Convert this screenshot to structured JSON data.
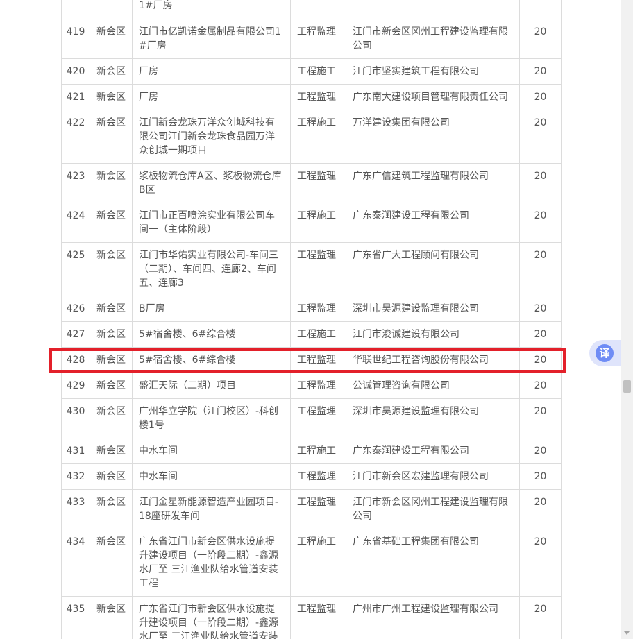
{
  "rows": [
    {
      "num": "",
      "district": "",
      "project": "1#厂房",
      "type": "",
      "company": "",
      "score": ""
    },
    {
      "num": "419",
      "district": "新会区",
      "project": "江门市亿凯诺金属制品有限公司1#厂房",
      "type": "工程监理",
      "company": "江门市新会区冈州工程建设监理有限公司",
      "score": "20"
    },
    {
      "num": "420",
      "district": "新会区",
      "project": "厂房",
      "type": "工程施工",
      "company": "江门市坚实建筑工程有限公司",
      "score": "20"
    },
    {
      "num": "421",
      "district": "新会区",
      "project": "厂房",
      "type": "工程监理",
      "company": "广东南大建设项目管理有限责任公司",
      "score": "20"
    },
    {
      "num": "422",
      "district": "新会区",
      "project": "江门新会龙珠万洋众创城科技有限公司江门新会龙珠食品园万洋众创城一期项目",
      "type": "工程施工",
      "company": "万洋建设集团有限公司",
      "score": "20"
    },
    {
      "num": "423",
      "district": "新会区",
      "project": "浆板物流仓库A区、浆板物流仓库B区",
      "type": "工程监理",
      "company": "广东广信建筑工程监理有限公司",
      "score": "20"
    },
    {
      "num": "424",
      "district": "新会区",
      "project": "江门市正百喷涂实业有限公司车间一（主体阶段）",
      "type": "工程施工",
      "company": "广东泰润建设工程有限公司",
      "score": "20"
    },
    {
      "num": "425",
      "district": "新会区",
      "project": "江门市华佑实业有限公司-车间三（二期）、车间四、连廊2、车间五、连廊3",
      "type": "工程监理",
      "company": "广东省广大工程顾问有限公司",
      "score": "20"
    },
    {
      "num": "426",
      "district": "新会区",
      "project": "B厂房",
      "type": "工程监理",
      "company": "深圳市昊源建设监理有限公司",
      "score": "20"
    },
    {
      "num": "427",
      "district": "新会区",
      "project": "5#宿舍楼、6#综合楼",
      "type": "工程施工",
      "company": "江门市浚诚建设有限公司",
      "score": "20"
    },
    {
      "num": "428",
      "district": "新会区",
      "project": "5#宿舍楼、6#综合楼",
      "type": "工程监理",
      "company": "华联世纪工程咨询股份有限公司",
      "score": "20"
    },
    {
      "num": "429",
      "district": "新会区",
      "project": "盛汇天际（二期）项目",
      "type": "工程监理",
      "company": "公诚管理咨询有限公司",
      "score": "20"
    },
    {
      "num": "430",
      "district": "新会区",
      "project": "广州华立学院（江门校区）-科创楼1号",
      "type": "工程监理",
      "company": "深圳市昊源建设监理有限公司",
      "score": "20"
    },
    {
      "num": "431",
      "district": "新会区",
      "project": "中水车间",
      "type": "工程施工",
      "company": "广东泰润建设工程有限公司",
      "score": "20"
    },
    {
      "num": "432",
      "district": "新会区",
      "project": "中水车间",
      "type": "工程监理",
      "company": "江门市新会区宏建监理有限公司",
      "score": "20"
    },
    {
      "num": "433",
      "district": "新会区",
      "project": "江门金星新能源智造产业园项目-18座研发车间",
      "type": "工程监理",
      "company": "江门市新会区冈州工程建设监理有限公司",
      "score": "20"
    },
    {
      "num": "434",
      "district": "新会区",
      "project": "广东省江门市新会区供水设施提升建设项目（一阶段二期）-鑫源水厂至 三江渔业队给水管道安装工程",
      "type": "工程施工",
      "company": "广东省基础工程集团有限公司",
      "score": "20"
    },
    {
      "num": "435",
      "district": "新会区",
      "project": "广东省江门市新会区供水设施提升建设项目（一阶段二期）-鑫源水厂至 三江渔业队给水管道安装工程",
      "type": "工程监理",
      "company": "广州市广州工程建设监理有限公司",
      "score": "20"
    }
  ],
  "translate": {
    "label": "译"
  },
  "colors": {
    "highlight": "#e3202a",
    "translate_accent": "#6f8cf5"
  }
}
